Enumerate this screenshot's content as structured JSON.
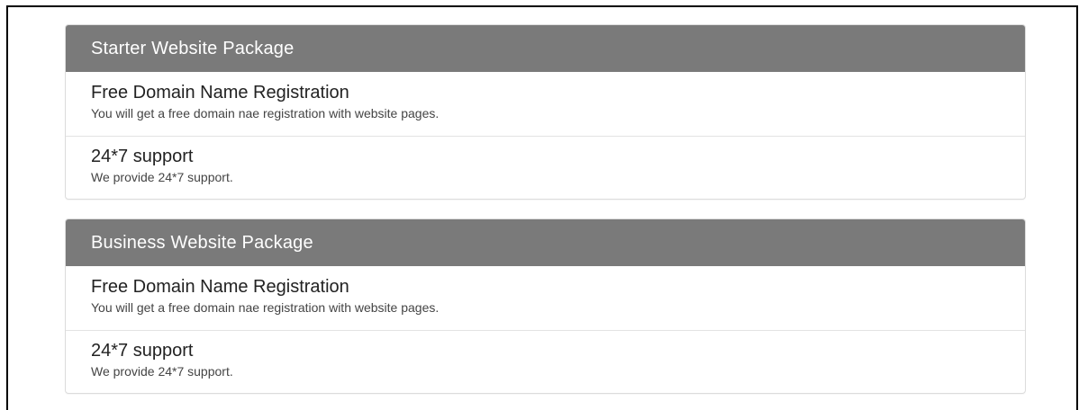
{
  "packages": [
    {
      "title": "Starter Website Package",
      "items": [
        {
          "heading": "Free Domain Name Registration",
          "text": "You will get a free domain nae registration with website pages."
        },
        {
          "heading": "24*7 support",
          "text": "We provide 24*7 support."
        }
      ]
    },
    {
      "title": "Business Website Package",
      "items": [
        {
          "heading": "Free Domain Name Registration",
          "text": "You will get a free domain nae registration with website pages."
        },
        {
          "heading": "24*7 support",
          "text": "We provide 24*7 support."
        }
      ]
    }
  ],
  "colors": {
    "panel_heading_bg": "#7a7a7a",
    "panel_heading_text": "#ffffff",
    "border": "#dcdcdc"
  }
}
